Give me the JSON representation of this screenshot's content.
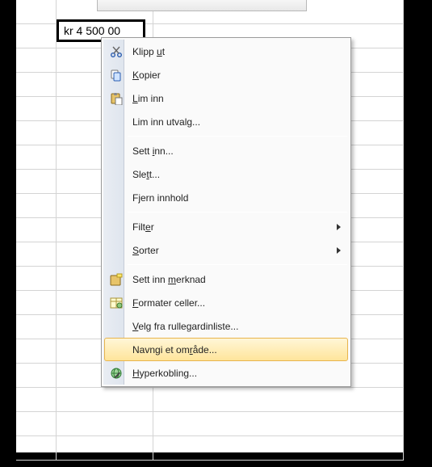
{
  "cell": {
    "value": "kr  4 500 00"
  },
  "menu": {
    "cut": {
      "label": "Klipp ut",
      "ak": "u"
    },
    "copy": {
      "label": "Kopier",
      "ak": "K"
    },
    "paste": {
      "label": "Lim inn",
      "ak": "L"
    },
    "paste_sp": {
      "label": "Lim inn utvalg..."
    },
    "insert": {
      "label": "Sett inn...",
      "ak": "i"
    },
    "delete": {
      "label": "Slett...",
      "ak": "t"
    },
    "clear": {
      "label": "Fjern innhold"
    },
    "filter": {
      "label": "Filter",
      "ak": "e"
    },
    "sort": {
      "label": "Sorter",
      "ak": "S"
    },
    "comment": {
      "label": "Sett inn merknad",
      "ak": "m"
    },
    "format": {
      "label": "Formater celler...",
      "ak": "F"
    },
    "picklist": {
      "label": "Velg fra rullegardinliste...",
      "ak": "V"
    },
    "namerange": {
      "label": "Navngi et område...",
      "ak": "r"
    },
    "hyperlink": {
      "label": "Hyperkobling...",
      "ak": "H"
    }
  }
}
